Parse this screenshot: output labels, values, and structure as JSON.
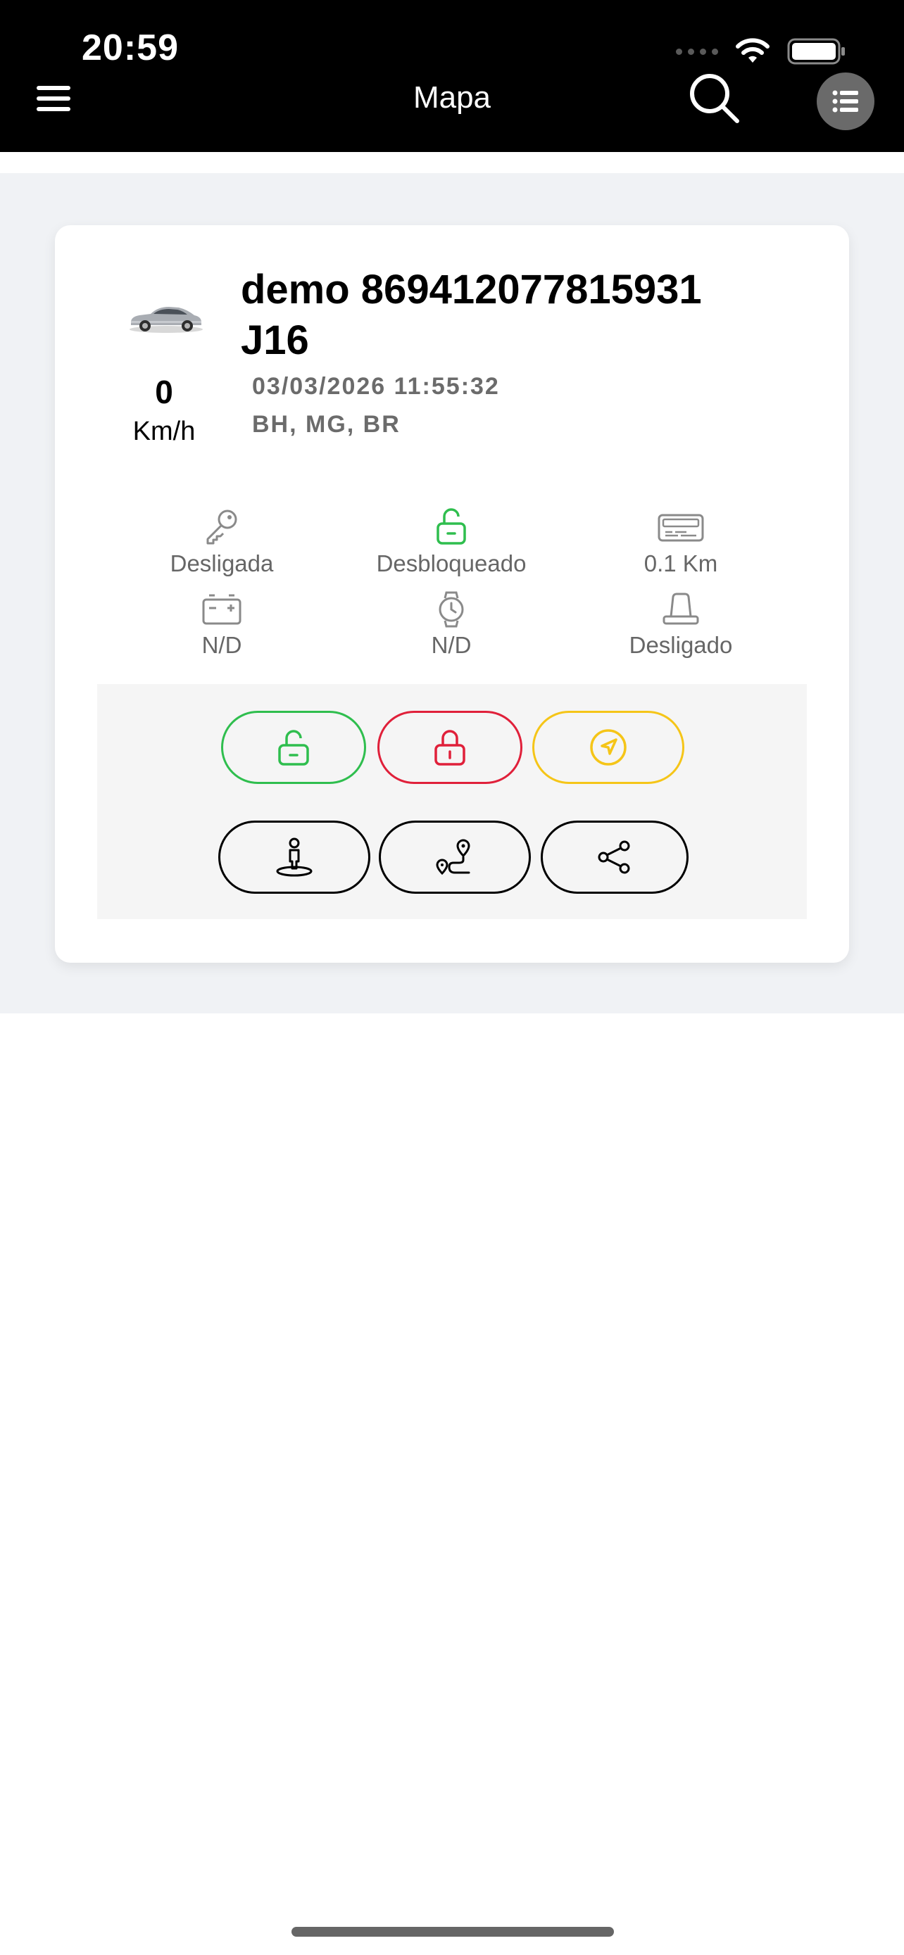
{
  "status_bar": {
    "time": "20:59"
  },
  "nav": {
    "title": "Mapa",
    "menu_icon": "hamburger-icon",
    "search_icon": "search-icon",
    "list_icon": "list-icon"
  },
  "vehicle": {
    "name": "demo 869412077815931 J16",
    "datetime": "03/03/2026 11:55:32",
    "location": "BH, MG, BR",
    "speed": "0",
    "speed_unit": "Km/h"
  },
  "stats": [
    {
      "icon": "key-icon",
      "label": "Desligada",
      "color": "#8a8a8a"
    },
    {
      "icon": "unlocked-icon",
      "label": "Desbloqueado",
      "color": "#2fbe4e"
    },
    {
      "icon": "odometer-icon",
      "label": "0.1 Km",
      "color": "#8a8a8a"
    },
    {
      "icon": "battery-icon",
      "label": "N/D",
      "color": "#8a8a8a"
    },
    {
      "icon": "watch-icon",
      "label": "N/D",
      "color": "#8a8a8a"
    },
    {
      "icon": "siren-icon",
      "label": "Desligado",
      "color": "#8a8a8a"
    }
  ],
  "actions": {
    "unlock": {
      "icon": "unlock-icon",
      "color": "#2fbe4e"
    },
    "lock": {
      "icon": "lock-icon",
      "color": "#e0203a"
    },
    "navigate": {
      "icon": "navigation-icon",
      "color": "#f5c518"
    },
    "street_view": {
      "icon": "street-view-icon",
      "color": "#000000"
    },
    "route": {
      "icon": "route-icon",
      "color": "#000000"
    },
    "share": {
      "icon": "share-icon",
      "color": "#000000"
    }
  },
  "colors": {
    "header_bg": "#000000",
    "content_bg": "#f0f2f5",
    "card_bg": "#ffffff",
    "green": "#2fbe4e",
    "red": "#e0203a",
    "yellow": "#f5c518"
  }
}
